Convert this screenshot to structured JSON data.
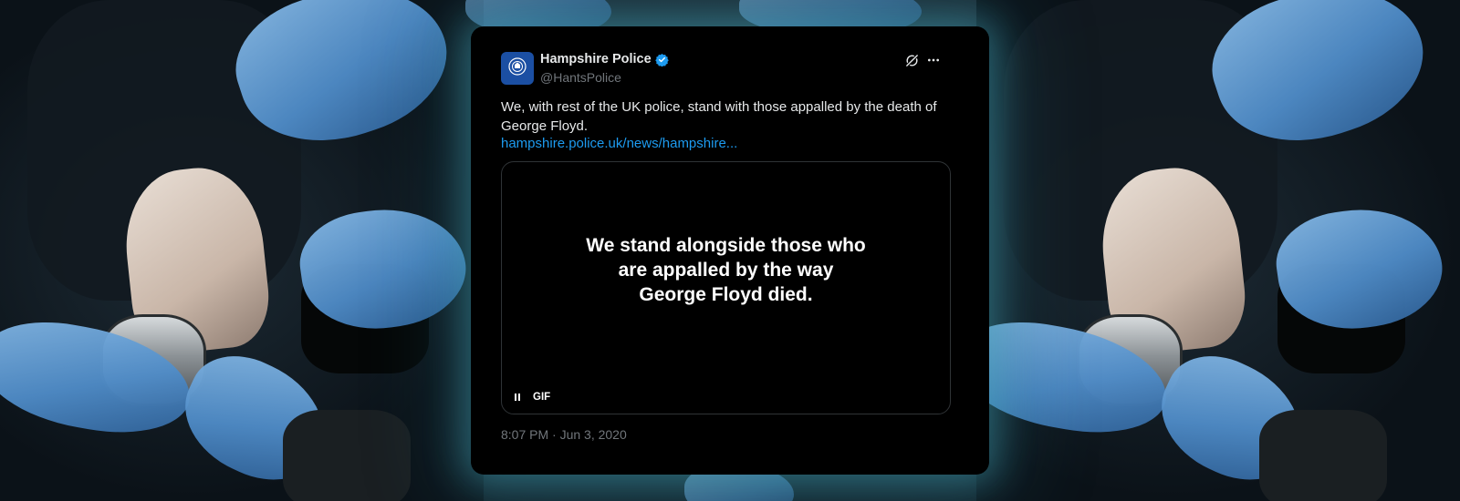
{
  "tweet": {
    "author_name": "Hampshire Police",
    "handle": "@HantsPolice",
    "text": "We, with rest of the UK police, stand with those appalled by the death of George Floyd.",
    "link": "hampshire.police.uk/news/hampshire...",
    "media_lines": [
      "We stand alongside those who",
      "are appalled by the way",
      "George Floyd died."
    ],
    "gif_label": "GIF",
    "timestamp": "8:07 PM · Jun 3, 2020"
  },
  "icons": {
    "avatar": "police-crest-icon",
    "verified": "verified-badge-icon",
    "grok": "grok-icon",
    "more": "more-options-icon",
    "pause": "pause-icon"
  },
  "colors": {
    "card_background": "#000000",
    "link": "#1d9bf0",
    "verified": "#1d9bf0",
    "secondary_text": "#71767b",
    "glow": "#46aabe",
    "glove": "#5b97d2"
  }
}
